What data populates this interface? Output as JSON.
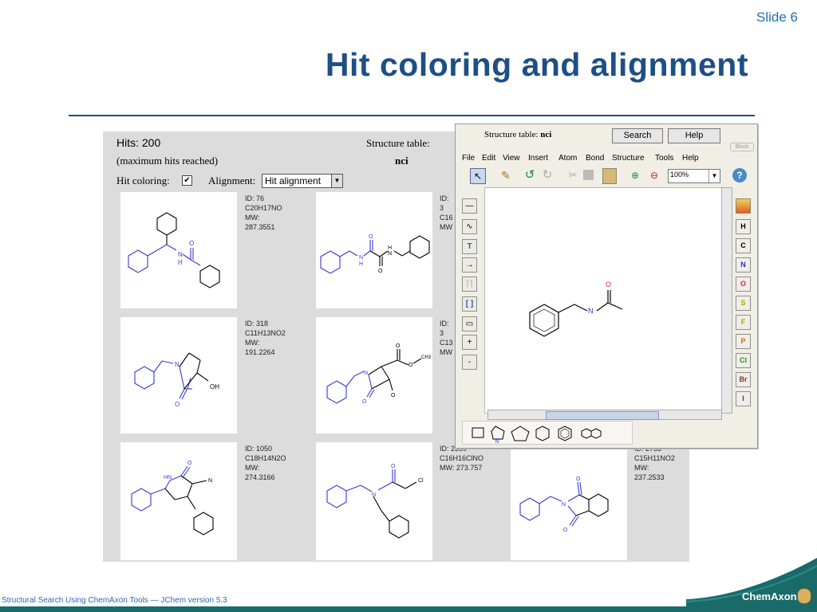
{
  "slide": {
    "number": "Slide 6",
    "title": "Hit coloring and alignment",
    "footer": "Structural Search Using ChemAxon Tools  —  JChem version 5.3",
    "logo": "ChemAxon"
  },
  "results": {
    "hits": "Hits: 200",
    "max_hits": "(maximum hits reached)",
    "hit_coloring_label": "Hit coloring:",
    "alignment_label": "Alignment:",
    "alignment_value": "Hit alignment",
    "structure_table_label": "Structure table:",
    "structure_table_value": "nci",
    "cells": [
      {
        "id": "ID: 76",
        "formula": "C20H17NO",
        "mw": "MW: 287.3551"
      },
      {
        "id": "ID: 3",
        "formula": "C16",
        "mw": "MW"
      },
      {
        "id": "ID: 318",
        "formula": "C11H13NO2",
        "mw": "MW: 191.2264"
      },
      {
        "id": "ID: 3",
        "formula": "C13",
        "mw": "MW"
      },
      {
        "id": "ID: 1050",
        "formula": "C18H14N2O",
        "mw": "MW: 274.3166"
      },
      {
        "id": "ID: 2359",
        "formula": "C16H16ClNO",
        "mw": "MW: 273.757"
      },
      {
        "id": "ID: 2753",
        "formula": "C15H11NO2",
        "mw": "MW: 237.2533"
      }
    ]
  },
  "sketcher": {
    "structure_table_label": "Structure table:",
    "structure_table_value": "nci",
    "search_button": "Search",
    "help_button": "Help",
    "block_label": "Block",
    "menu": [
      "File",
      "Edit",
      "View",
      "Insert",
      "Atom",
      "Bond",
      "Structure",
      "Tools",
      "Help"
    ],
    "zoom": "100%",
    "atoms": [
      "H",
      "C",
      "N",
      "O",
      "S",
      "F",
      "P",
      "Cl",
      "Br",
      "I"
    ],
    "atom_colors": [
      "#000000",
      "#000000",
      "#2a2ad8",
      "#d82a2a",
      "#b8a000",
      "#b8a000",
      "#c07a00",
      "#1a9a1a",
      "#8a3a1a",
      "#7a1a9a"
    ],
    "query_atoms": {
      "n": "N",
      "o": "O"
    },
    "left_tools": [
      "T",
      "+",
      "-"
    ],
    "templates": [
      "cyclobutane-icon",
      "pyrrole-icon",
      "cyclopentane-icon",
      "cyclohexane-icon",
      "benzene-icon",
      "naphthalene-icon"
    ]
  },
  "molecule_labels": {
    "m1_n": "N",
    "m1_h": "H",
    "m1_o": "O",
    "m2_n1": "N",
    "m2_h1": "H",
    "m2_n2": "N",
    "m2_h2": "H",
    "m2_o1": "O",
    "m2_o2": "O",
    "m3_n": "N",
    "m3_o": "O",
    "m3_oh": "OH",
    "m4_n": "N",
    "m4_o1": "O",
    "m4_o2": "O",
    "m4_o3": "O",
    "m4_o4": "O",
    "m4_ch3": "CH3",
    "m5_hn": "HN",
    "m5_o": "O",
    "m5_n": "N",
    "m6_n": "N",
    "m6_o": "O",
    "m6_cl": "Cl",
    "m7_n": "N",
    "m7_o1": "O",
    "m7_o2": "O"
  },
  "colors": {
    "title": "#1d4f86",
    "hit": "#3a3ad6",
    "panel": "#dcdcdc"
  }
}
